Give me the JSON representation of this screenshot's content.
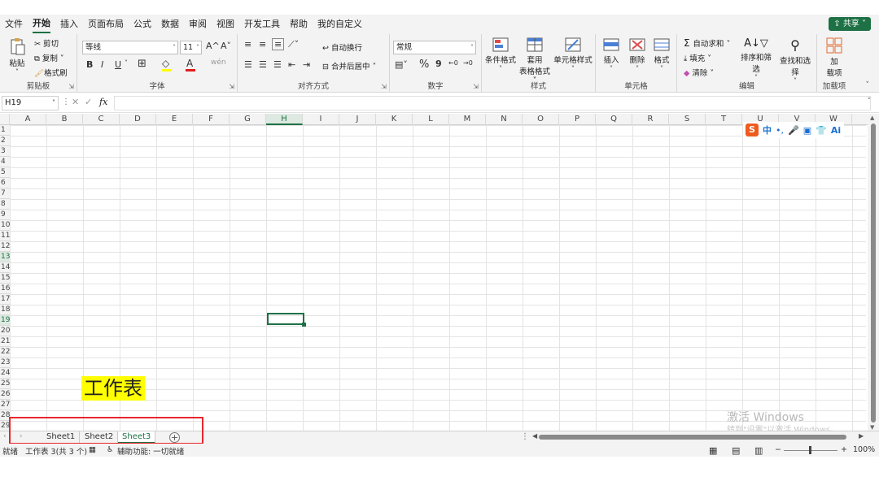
{
  "menu": {
    "items": [
      "文件",
      "开始",
      "插入",
      "页面布局",
      "公式",
      "数据",
      "审阅",
      "视图",
      "开发工具",
      "帮助",
      "我的自定义"
    ],
    "active_index": 1,
    "share": "共享"
  },
  "ribbon": {
    "clipboard": {
      "paste": "粘贴",
      "cut": "剪切",
      "copy": "复制",
      "format_painter": "格式刷",
      "label": "剪贴板"
    },
    "font": {
      "name": "等线",
      "size": "11",
      "bold": "B",
      "italic": "I",
      "underline": "U",
      "grow": "A^",
      "shrink": "A˅",
      "label": "字体"
    },
    "alignment": {
      "wrap": "自动换行",
      "merge": "合并后居中",
      "label": "对齐方式"
    },
    "number": {
      "format": "常规",
      "percent": "%",
      "comma": "9",
      "label": "数字"
    },
    "styles": {
      "conditional": "条件格式",
      "table_line1": "套用",
      "table_line2": "表格格式",
      "cell_styles": "单元格样式",
      "label": "样式"
    },
    "cells": {
      "insert": "插入",
      "delete": "删除",
      "format": "格式",
      "label": "单元格"
    },
    "editing": {
      "autosum": "自动求和",
      "fill": "填充",
      "clear": "清除",
      "sort_filter": "排序和筛选",
      "find_select": "查找和选择",
      "label": "编辑"
    },
    "addins": {
      "line1": "加",
      "line2": "载项",
      "label": "加载项"
    }
  },
  "formula_bar": {
    "namebox": "H19",
    "fx": "fx",
    "value": ""
  },
  "grid": {
    "columns": [
      "A",
      "B",
      "C",
      "D",
      "E",
      "F",
      "G",
      "H",
      "I",
      "J",
      "K",
      "L",
      "M",
      "N",
      "O",
      "P",
      "Q",
      "R",
      "S",
      "T",
      "U",
      "V",
      "W"
    ],
    "rows": [
      "1",
      "2",
      "3",
      "4",
      "5",
      "6",
      "7",
      "8",
      "9",
      "10",
      "11",
      "12",
      "13",
      "14",
      "15",
      "16",
      "17",
      "18",
      "19",
      "20",
      "21",
      "22",
      "23",
      "24",
      "25",
      "26",
      "27",
      "28",
      "29"
    ],
    "selected_col": "H",
    "selected_row": "19",
    "highlighted_row": "13"
  },
  "ime": {
    "logo": "S",
    "lang": "中",
    "ai": "Ai"
  },
  "annotation": "工作表",
  "sheets": {
    "tabs": [
      "Sheet1",
      "Sheet2",
      "Sheet3"
    ],
    "active": "Sheet3",
    "add": "+"
  },
  "status": {
    "ready": "就绪",
    "sheet_count": "工作表 3(共 3 个)",
    "accessibility": "辅助功能: 一切就绪",
    "zoom": "100%"
  },
  "watermark": {
    "line1": "激活 Windows",
    "line2": "转到\"设置\"以激活 Windows。"
  },
  "colors": {
    "accent": "#1e7145",
    "highlight": "#ffff00",
    "annotation_box": "#e8262b"
  }
}
